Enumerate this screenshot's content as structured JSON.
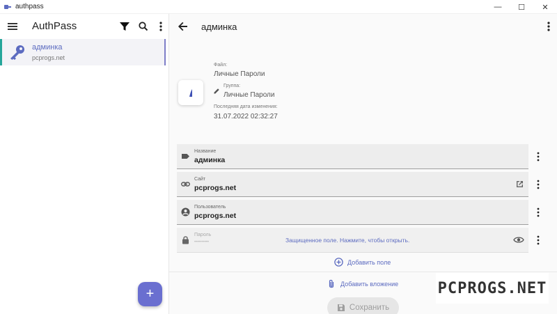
{
  "window": {
    "title": "authpass",
    "controls": {
      "minimize": "—",
      "maximize": "☐",
      "close": "✕"
    }
  },
  "left_panel": {
    "app_name": "AuthPass",
    "icons": [
      "menu-icon",
      "filter-icon",
      "search-icon",
      "more-vert-icon"
    ],
    "entries": [
      {
        "title": "админка",
        "subtitle": "pcprogs.net",
        "icon": "key-icon",
        "selected": true
      }
    ],
    "fab_label": "+"
  },
  "right_panel": {
    "title": "админка",
    "meta": {
      "file_label": "Файл:",
      "file_value": "Личные Пароли",
      "group_label": "Группа:",
      "group_value": "Личные Пароли",
      "modified_label": "Последняя дата изменения:",
      "modified_value": "31.07.2022 02:32:27"
    },
    "fields": [
      {
        "label": "Название",
        "value": "админка",
        "icon": "label-icon",
        "action_icon": ""
      },
      {
        "label": "Сайт",
        "value": "pcprogs.net",
        "icon": "link-icon",
        "action_icon": "open-external-icon"
      },
      {
        "label": "Пользователь",
        "value": "pcprogs.net",
        "icon": "account-icon",
        "action_icon": ""
      }
    ],
    "password_field": {
      "label": "Пароль",
      "protected_text": "Защищенное поле. Нажмите, чтобы открыть.",
      "icon": "lock-icon",
      "action_icon": "eye-icon"
    },
    "add_field_label": "Добавить поле",
    "add_attachment_label": "Добавить вложение",
    "save_label": "Сохранить"
  },
  "colors": {
    "accent": "#5c6bc0",
    "fab": "#6a6fd0",
    "selection_bar": "#26a69a"
  },
  "watermark": "PCPROGS.NET"
}
